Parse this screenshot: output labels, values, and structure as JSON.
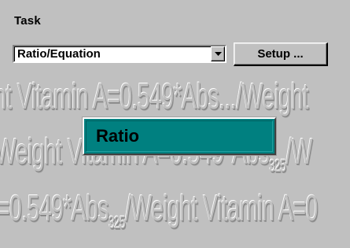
{
  "task": {
    "label": "Task",
    "selected": "Ratio/Equation",
    "setup_label": "Setup ..."
  },
  "watermark": {
    "line1": "ht   Vitamin A=0.549*Abs.../Weight",
    "line2": "Weight   Vitamin A=0.549*Abs",
    "line2_sub": "325",
    "line2_tail": "/W",
    "line3": "=0.549*Abs",
    "line3_sub": "325",
    "line3_tail": "/Weight   Vitamin A=0"
  },
  "selection": {
    "label": "Ratio"
  },
  "colors": {
    "background": "#c0c0c0",
    "selection_fill": "#008080"
  },
  "icons": {
    "combo_arrow": "chevron-down-icon"
  }
}
